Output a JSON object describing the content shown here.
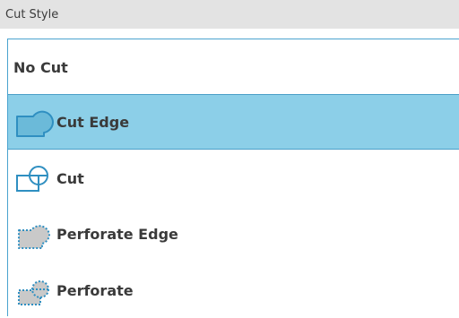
{
  "panel": {
    "title": "Cut Style"
  },
  "options": [
    {
      "label": "No Cut",
      "icon": "none",
      "selected": false
    },
    {
      "label": "Cut Edge",
      "icon": "cut-edge-icon",
      "selected": true
    },
    {
      "label": "Cut",
      "icon": "cut-icon",
      "selected": false
    },
    {
      "label": "Perforate Edge",
      "icon": "perforate-edge-icon",
      "selected": false
    },
    {
      "label": "Perforate",
      "icon": "perforate-icon",
      "selected": false
    }
  ],
  "colors": {
    "selected_bg": "#8ccfe8",
    "selected_border": "#4a9fc8",
    "icon_stroke": "#2f8fc1",
    "header_bg": "#e3e3e3"
  }
}
